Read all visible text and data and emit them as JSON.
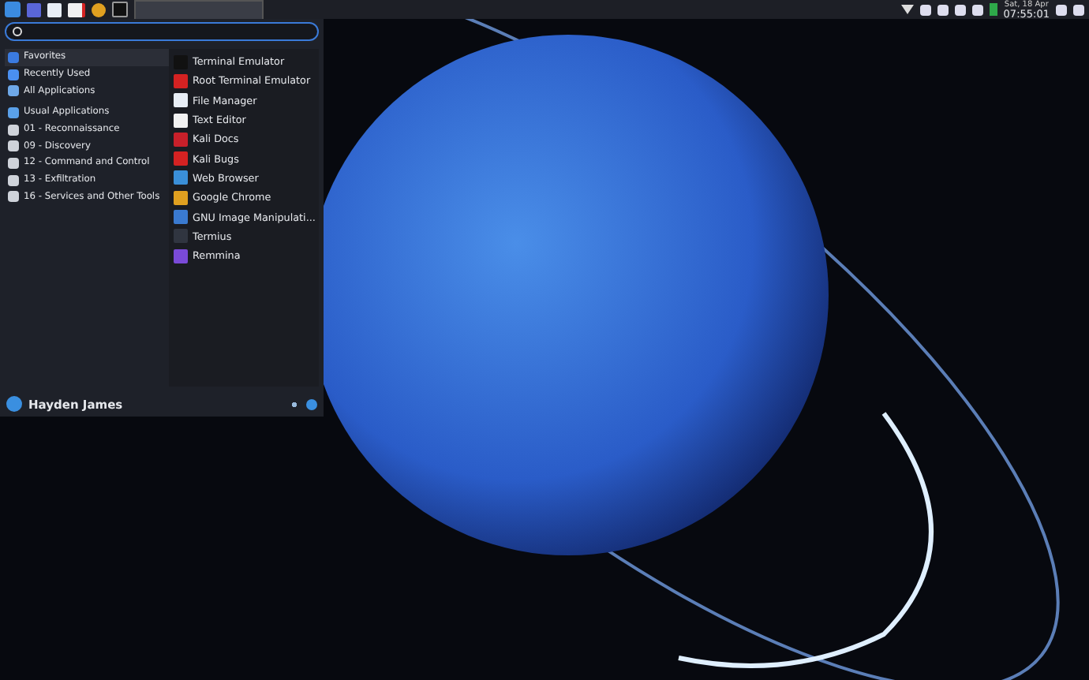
{
  "panel": {
    "date": "Sat, 18 Apr",
    "time": "07:55:01"
  },
  "menu": {
    "categories": [
      {
        "label": "Favorites",
        "selected": true
      },
      {
        "label": "Recently Used",
        "selected": false
      },
      {
        "label": "All Applications",
        "selected": false
      },
      {
        "label": "Usual Applications",
        "selected": false
      },
      {
        "label": "01 - Reconnaissance",
        "selected": false
      },
      {
        "label": "09 - Discovery",
        "selected": false
      },
      {
        "label": "12 - Command and Control",
        "selected": false
      },
      {
        "label": "13 - Exfiltration",
        "selected": false
      },
      {
        "label": "16 - Services and Other Tools",
        "selected": false
      }
    ],
    "apps": [
      "Terminal Emulator",
      "Root Terminal Emulator",
      "File Manager",
      "Text Editor",
      "Kali Docs",
      "Kali Bugs",
      "Web Browser",
      "Google Chrome",
      "GNU Image Manipulati...",
      "Termius",
      "Remmina"
    ],
    "user": "Hayden James"
  }
}
